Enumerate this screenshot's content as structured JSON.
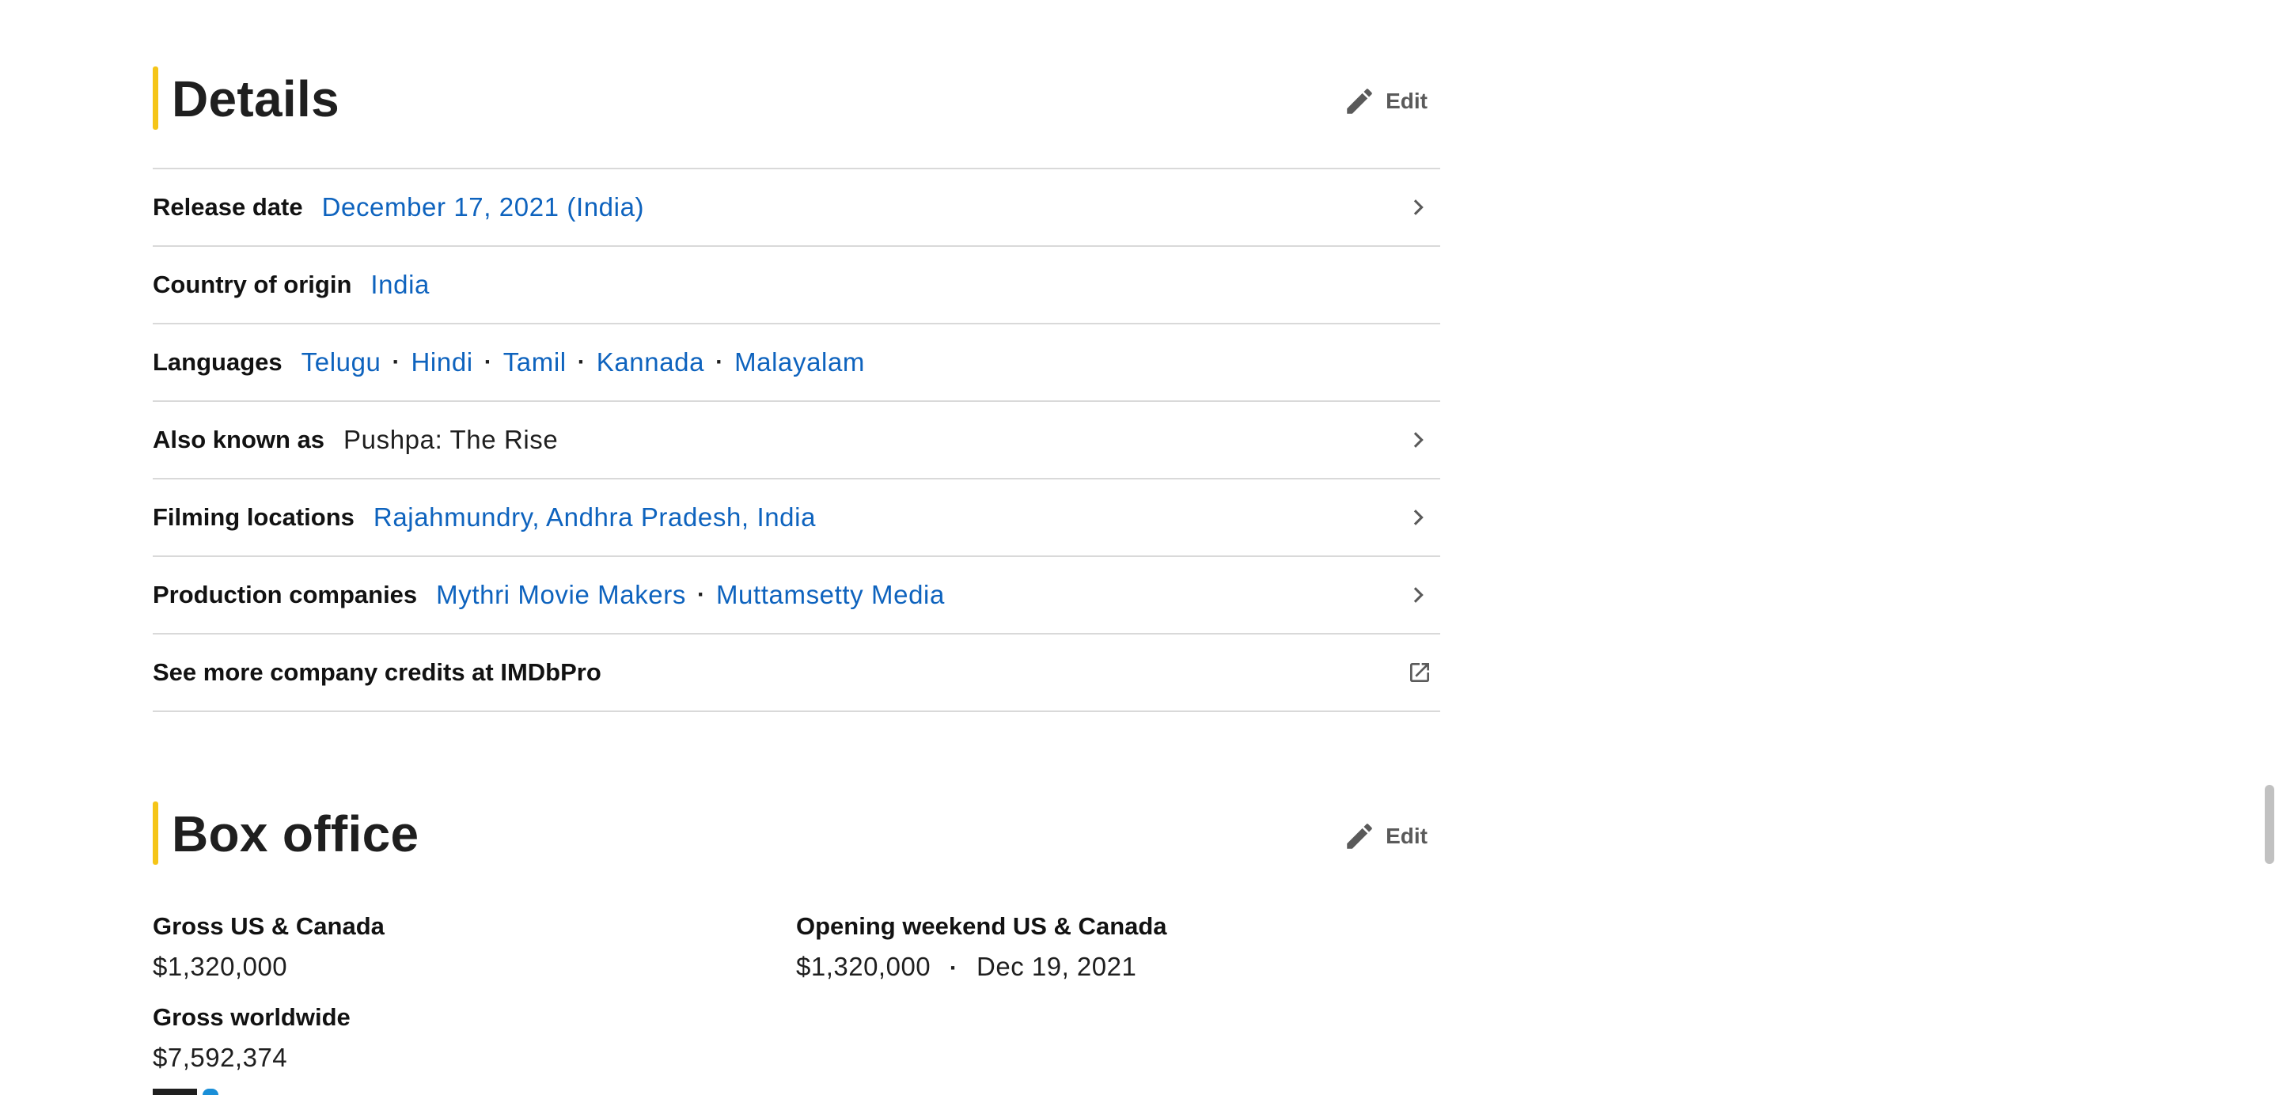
{
  "details": {
    "title": "Details",
    "edit_label": "Edit",
    "release_date": {
      "label": "Release date",
      "value": "December 17, 2021 (India)"
    },
    "country": {
      "label": "Country of origin",
      "value": "India"
    },
    "languages": {
      "label": "Languages",
      "values": [
        "Telugu",
        "Hindi",
        "Tamil",
        "Kannada",
        "Malayalam"
      ]
    },
    "aka": {
      "label": "Also known as",
      "value": "Pushpa: The Rise"
    },
    "filming": {
      "label": "Filming locations",
      "value": "Rajahmundry, Andhra Pradesh, India"
    },
    "production": {
      "label": "Production companies",
      "values": [
        "Mythri Movie Makers",
        "Muttamsetty Media"
      ]
    },
    "pro_link": {
      "label": "See more company credits at IMDbPro"
    }
  },
  "box_office": {
    "title": "Box office",
    "edit_label": "Edit",
    "gross_us": {
      "label": "Gross US & Canada",
      "value": "$1,320,000"
    },
    "opening": {
      "label": "Opening weekend US & Canada",
      "value": "$1,320,000",
      "date": "Dec 19, 2021"
    },
    "gross_world": {
      "label": "Gross worldwide",
      "value": "$7,592,374"
    }
  },
  "separator": "·",
  "colors": {
    "accent": "#f5c518",
    "link": "#0e63be",
    "text": "#1f1f1f",
    "divider": "#d9d9d9"
  },
  "icons": {
    "edit": "pencil-icon",
    "row": "chevron-right-icon",
    "external": "external-link-icon"
  }
}
